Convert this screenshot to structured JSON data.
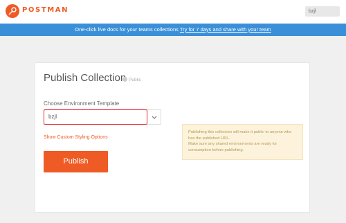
{
  "header": {
    "brand": "POSTMAN",
    "user_text": "bzjl"
  },
  "banner": {
    "text": "One-click live docs for your teams collections",
    "link": "Try for 7 days and share with your team"
  },
  "card": {
    "title": "Publish Collection",
    "visibility": "Public",
    "env_label": "Choose Environment Template",
    "env_value": "bzjl",
    "styling_link": "Show Custom Styling Options",
    "publish_label": "Publish",
    "notice_line1": "Publishing this collection will make it public to anyone who has the published URL.",
    "notice_line2": "Make sure any shared environments are ready for consumption before publishing."
  },
  "colors": {
    "accent": "#ef5b25",
    "banner": "#3a90d8",
    "highlight": "#e0242e",
    "notice_bg": "#fdf3dc"
  },
  "icons": [
    "postman-logo-icon",
    "globe-icon",
    "chevron-down-icon"
  ]
}
